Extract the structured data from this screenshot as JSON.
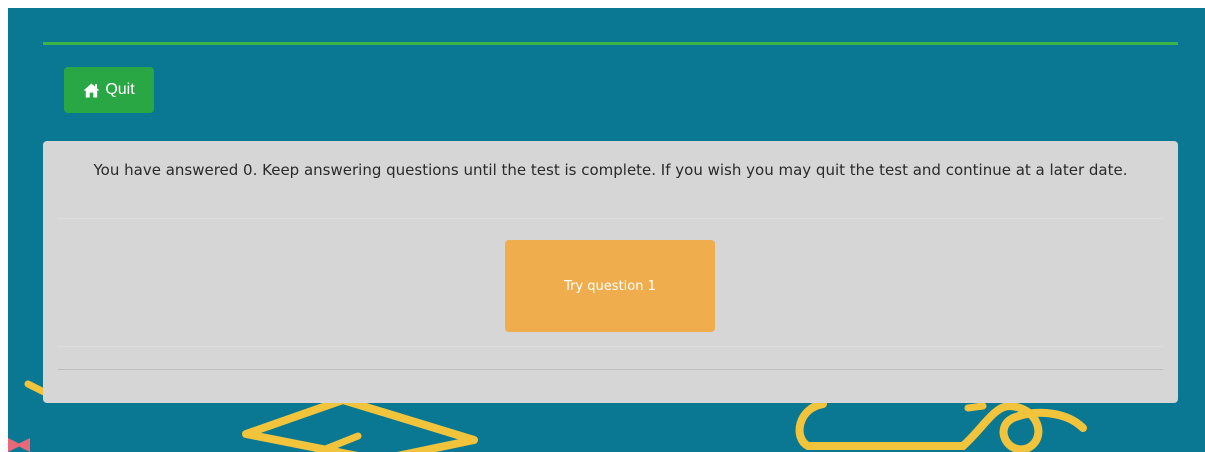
{
  "header": {
    "quit_label": "Quit",
    "quit_icon": "home-icon"
  },
  "panel": {
    "message": "You have answered 0. Keep answering questions until the test is complete. If you wish you may quit the test and continue at a later date.",
    "try_button_label": "Try question 1"
  },
  "colors": {
    "background": "#0a7893",
    "rule": "#3bb54a",
    "quit_button": "#2aa745",
    "panel": "#d6d6d6",
    "try_button": "#efad4e",
    "decoration_yellow": "#f2c43c",
    "decoration_pink": "#e9697a"
  }
}
